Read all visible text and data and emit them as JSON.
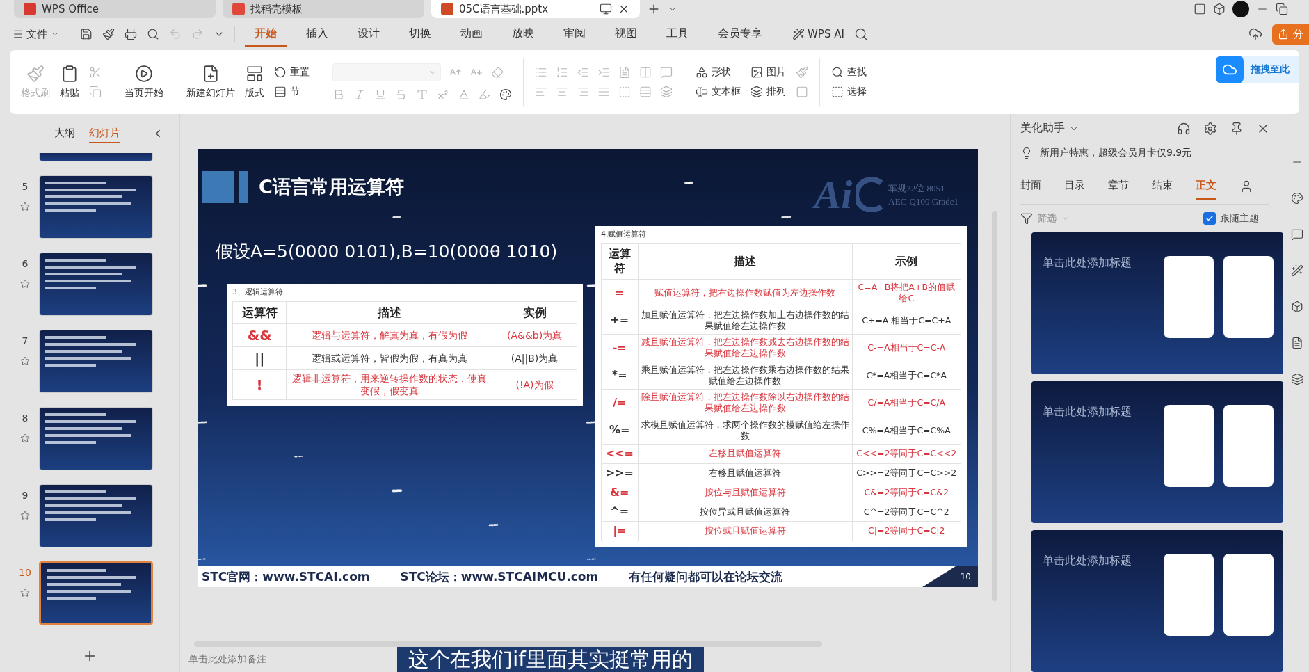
{
  "title_bar": {
    "tabs": [
      {
        "label": "WPS Office",
        "kind": "home",
        "selected": false
      },
      {
        "label": "找稻壳模板",
        "kind": "template",
        "selected": false
      },
      {
        "label": "05C语言基础.pptx",
        "kind": "document",
        "selected": true
      }
    ]
  },
  "menu": {
    "file": "文件",
    "tabs": [
      {
        "label": "开始",
        "selected": true
      },
      {
        "label": "插入",
        "selected": false
      },
      {
        "label": "设计",
        "selected": false
      },
      {
        "label": "切换",
        "selected": false
      },
      {
        "label": "动画",
        "selected": false
      },
      {
        "label": "放映",
        "selected": false
      },
      {
        "label": "审阅",
        "selected": false
      },
      {
        "label": "视图",
        "selected": false
      },
      {
        "label": "工具",
        "selected": false
      },
      {
        "label": "会员专享",
        "selected": false
      }
    ],
    "ai": "WPS AI",
    "share": "分"
  },
  "ribbon": {
    "format_painter": {
      "label": "格式刷",
      "disabled": true
    },
    "paste": {
      "label": "粘贴",
      "disabled": false
    },
    "play": {
      "label": "当页开始",
      "disabled": false
    },
    "new_slide": {
      "label": "新建幻灯片",
      "disabled": false
    },
    "layout": {
      "label": "版式",
      "disabled": false
    },
    "reset": {
      "label": "重置",
      "disabled": false
    },
    "section": {
      "label": "节",
      "disabled": false
    },
    "shape": {
      "label": "形状",
      "disabled": false
    },
    "picture": {
      "label": "图片",
      "disabled": false
    },
    "textbox": {
      "label": "文本框",
      "disabled": false
    },
    "arrange": {
      "label": "排列",
      "disabled": false
    },
    "find": {
      "label": "查找",
      "disabled": false
    },
    "select": {
      "label": "选择",
      "disabled": false
    },
    "drop_zone": "拖拽至此"
  },
  "sidebar": {
    "tabs": [
      {
        "label": "大纲",
        "selected": false
      },
      {
        "label": "幻灯片",
        "selected": true
      }
    ],
    "slides": [
      {
        "number": "5",
        "selected": false
      },
      {
        "number": "6",
        "selected": false
      },
      {
        "number": "7",
        "selected": false
      },
      {
        "number": "8",
        "selected": false
      },
      {
        "number": "9",
        "selected": false
      },
      {
        "number": "10",
        "selected": true
      }
    ]
  },
  "slide": {
    "title": "C语言常用运算符",
    "assumption": "假设A=5(0000 0101),B=10(0000 1010)",
    "logo": {
      "mark": "Ai",
      "line1": "车规32位 8051",
      "line2": "AEC-Q100 Grade1"
    },
    "tables": [
      {
        "caption": "3、逻辑运算符",
        "columns": [
          "运算符",
          "描述",
          "实例"
        ],
        "rows": [
          {
            "cells": [
              "&&",
              "逻辑与运算符，解真为真，有假为假",
              "(A&&b)为真"
            ],
            "color": "#d9363e"
          },
          {
            "cells": [
              "||",
              "逻辑或运算符，皆假为假，有真为真",
              "(A||B)为真"
            ],
            "color": "#333333"
          },
          {
            "cells": [
              "!",
              "逻辑非运算符，用来逆转操作数的状态，使真变假，假变真",
              "(!A)为假"
            ],
            "color": "#d9363e"
          }
        ]
      },
      {
        "caption": "4.赋值运算符",
        "columns": [
          "运算符",
          "描述",
          "示例"
        ],
        "rows": [
          {
            "cells": [
              "=",
              "赋值运算符，把右边操作数赋值为左边操作数",
              "C=A+B将把A+B的值赋给C"
            ],
            "color": "#d9363e"
          },
          {
            "cells": [
              "+=",
              "加且赋值运算符，把左边操作数加上右边操作数的结果赋值给左边操作数",
              "C+=A 相当于C=C+A"
            ],
            "color": "#333333"
          },
          {
            "cells": [
              "-=",
              "减且赋值运算符，把左边操作数减去右边操作数的结果赋值给左边操作数",
              "C-=A相当于C=C-A"
            ],
            "color": "#d9363e"
          },
          {
            "cells": [
              "*=",
              "乘且赋值运算符，把左边操作数乘右边操作数的结果赋值给左边操作数",
              "C*=A相当于C=C*A"
            ],
            "color": "#333333"
          },
          {
            "cells": [
              "/=",
              "除且赋值运算符，把左边操作数除以右边操作数的结果赋值给左边操作数",
              "C/=A相当于C=C/A"
            ],
            "color": "#d9363e"
          },
          {
            "cells": [
              "%=",
              "求模且赋值运算符，求两个操作数的模赋值给左操作数",
              "C%=A相当于C=C%A"
            ],
            "color": "#333333"
          },
          {
            "cells": [
              "<<=",
              "左移且赋值运算符",
              "C<<=2等同于C=C<<2"
            ],
            "color": "#d9363e"
          },
          {
            "cells": [
              ">>=",
              "右移且赋值运算符",
              "C>>=2等同于C=C>>2"
            ],
            "color": "#333333"
          },
          {
            "cells": [
              "&=",
              "按位与且赋值运算符",
              "C&=2等同于C=C&2"
            ],
            "color": "#d9363e"
          },
          {
            "cells": [
              "^=",
              "按位异或且赋值运算符",
              "C^=2等同于C=C^2"
            ],
            "color": "#333333"
          },
          {
            "cells": [
              "|=",
              "按位或且赋值运算符",
              "C|=2等同于C=C|2"
            ],
            "color": "#d9363e"
          }
        ]
      }
    ],
    "footer": {
      "links": [
        "STC官网：www.STCAI.com",
        "STC论坛：www.STCAIMCU.com",
        "有任何疑问都可以在论坛交流"
      ],
      "page": "10"
    }
  },
  "notes": "单击此处添加备注",
  "caption": "这个在我们if里面其实挺常用的",
  "panel": {
    "title": "美化助手",
    "promo": "新用户特惠，超级会员月卡仅9.9元",
    "tabs": [
      {
        "label": "封面",
        "selected": false
      },
      {
        "label": "目录",
        "selected": false
      },
      {
        "label": "章节",
        "selected": false
      },
      {
        "label": "结束",
        "selected": false
      },
      {
        "label": "正文",
        "selected": true
      }
    ],
    "filter": "筛选",
    "follow_theme": {
      "label": "跟随主题",
      "checked": true
    },
    "templates": [
      {
        "title": "单击此处添加标题"
      },
      {
        "title": "单击此处添加标题"
      },
      {
        "title": "单击此处添加标题"
      }
    ]
  }
}
